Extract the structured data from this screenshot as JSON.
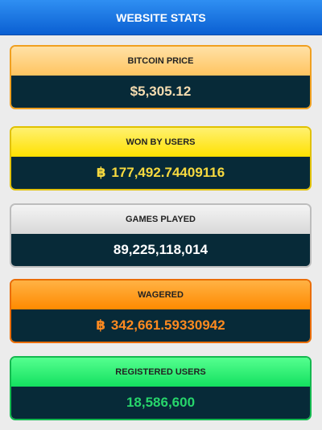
{
  "header": {
    "title": "WEBSITE STATS"
  },
  "stats": [
    {
      "label": "BITCOIN PRICE",
      "value": "$5,305.12",
      "symbol": "",
      "top": "#ffd27a",
      "border": "#f0a020",
      "text": "#f5dcb0"
    },
    {
      "label": "WON BY USERS",
      "value": "177,492.74409116",
      "symbol": "฿",
      "top": "#ffe81a",
      "border": "#e1c100",
      "text": "#f6d93f"
    },
    {
      "label": "GAMES PLAYED",
      "value": "89,225,118,014",
      "symbol": "",
      "top": "#e6e6e6",
      "border": "#bdbdbd",
      "text": "#ffffff"
    },
    {
      "label": "WAGERED",
      "value": "342,661.59330942",
      "symbol": "฿",
      "top": "#ff9a1f",
      "border": "#ea6d00",
      "text": "#ff8a1f"
    },
    {
      "label": "REGISTERED USERS",
      "value": "18,586,600",
      "symbol": "",
      "top": "#18f06a",
      "border": "#13b94f",
      "text": "#27d56b"
    }
  ]
}
